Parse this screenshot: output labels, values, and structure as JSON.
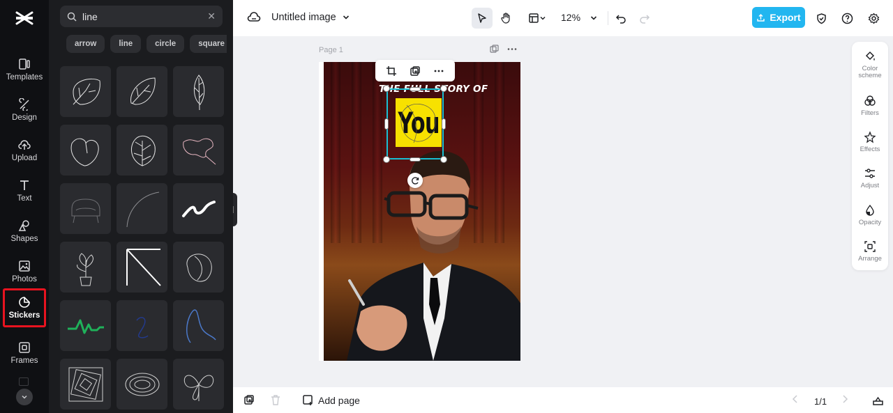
{
  "app": {
    "document_title": "Untitled image",
    "zoom": "12%",
    "export_label": "Export"
  },
  "rail": {
    "items": [
      {
        "label": "Templates",
        "icon": "templates-icon"
      },
      {
        "label": "Design",
        "icon": "design-icon"
      },
      {
        "label": "Upload",
        "icon": "upload-icon"
      },
      {
        "label": "Text",
        "icon": "text-icon"
      },
      {
        "label": "Shapes",
        "icon": "shapes-icon"
      },
      {
        "label": "Photos",
        "icon": "photos-icon"
      },
      {
        "label": "Stickers",
        "icon": "stickers-icon",
        "active": true
      },
      {
        "label": "Frames",
        "icon": "frames-icon"
      }
    ]
  },
  "panel": {
    "search_value": "line",
    "chips": [
      "arrow",
      "line",
      "circle",
      "square"
    ]
  },
  "canvas": {
    "page_label": "Page 1",
    "headline": "THE FULL STORY OF",
    "highlight_word": "You"
  },
  "right_tools": [
    {
      "label": "Color scheme",
      "icon": "color-scheme-icon"
    },
    {
      "label": "Filters",
      "icon": "filters-icon"
    },
    {
      "label": "Effects",
      "icon": "effects-icon"
    },
    {
      "label": "Adjust",
      "icon": "adjust-icon"
    },
    {
      "label": "Opacity",
      "icon": "opacity-icon"
    },
    {
      "label": "Arrange",
      "icon": "arrange-icon"
    }
  ],
  "bottom": {
    "add_page_label": "Add page",
    "pager": "1/1"
  },
  "colors": {
    "accent": "#22b6f0",
    "active_outline": "#e8131f",
    "selection": "#19c0d4",
    "highlight_bg": "#f7e100"
  }
}
